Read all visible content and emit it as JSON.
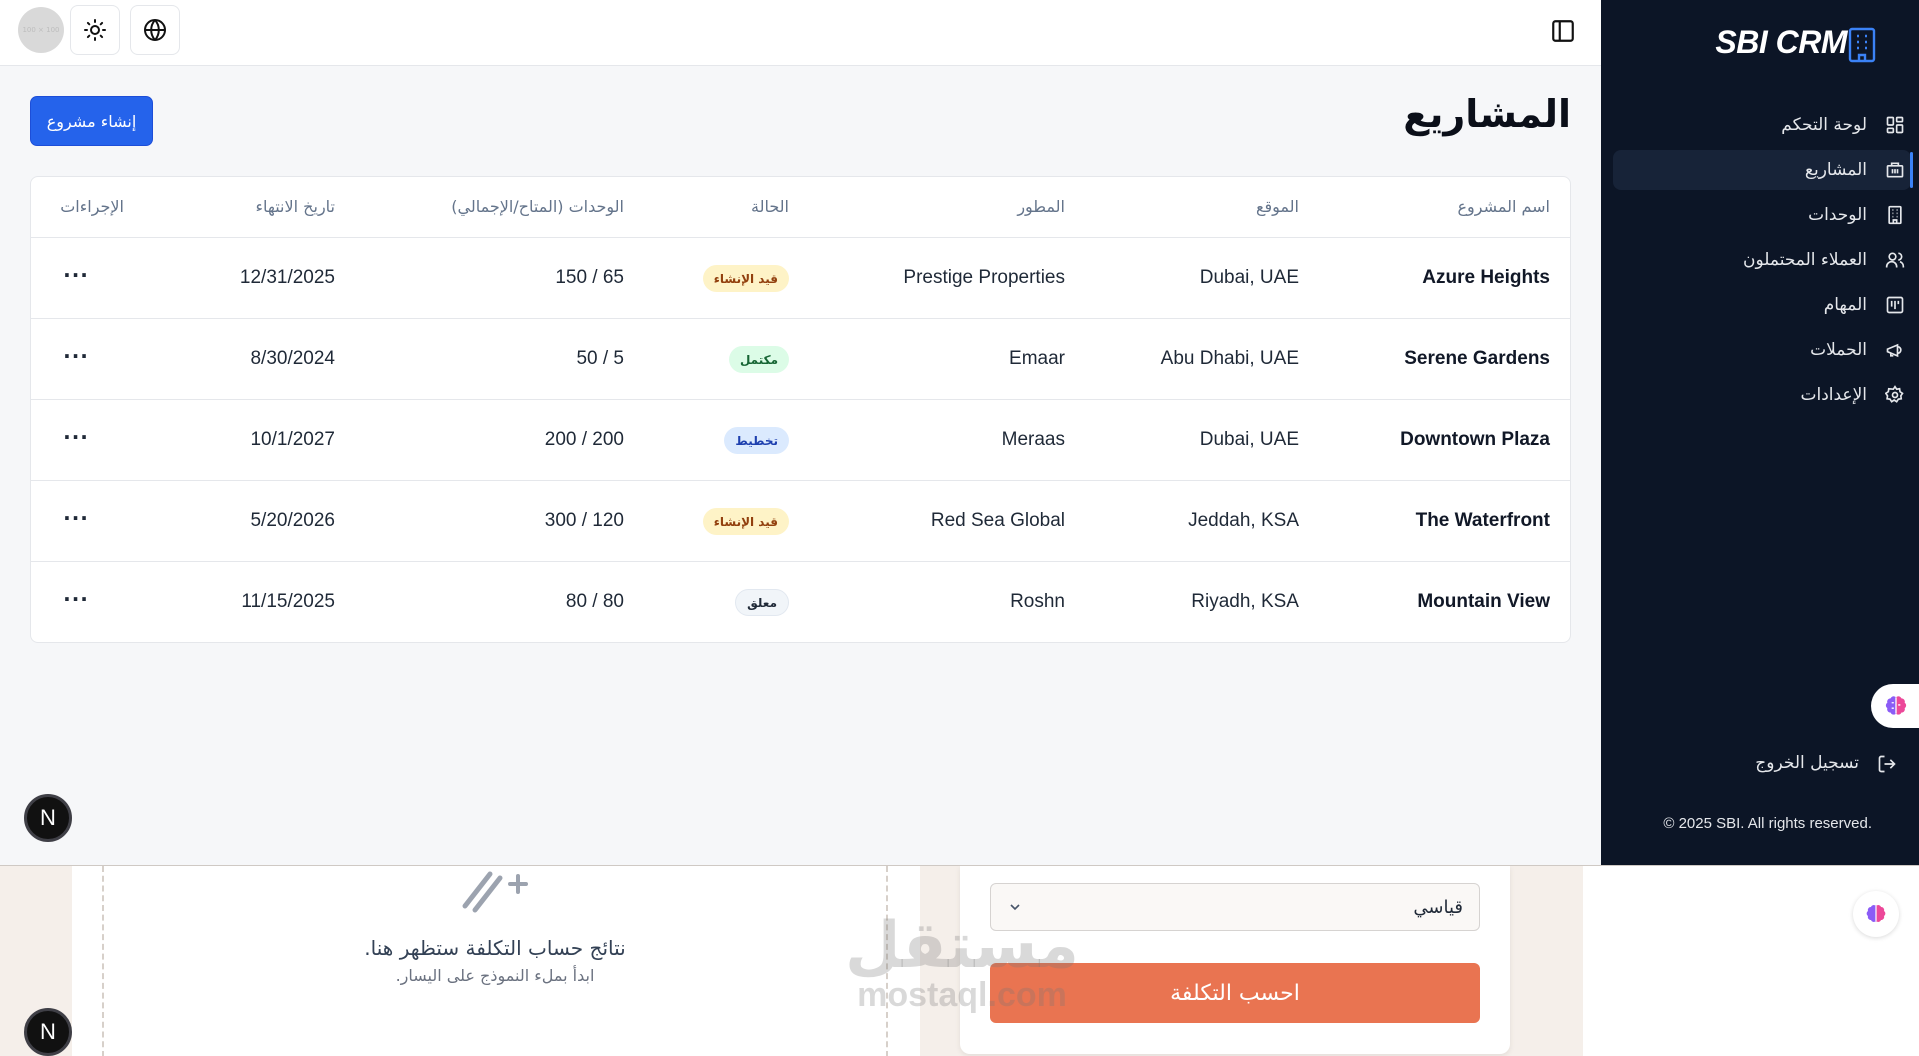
{
  "topbar": {
    "avatar_text": "100 × 100",
    "theme_icon": "sun-icon",
    "language_icon": "globe-icon",
    "panel_icon": "sidebar-toggle-icon"
  },
  "page": {
    "title": "المشاريع",
    "create_button": "إنشاء مشروع"
  },
  "table": {
    "headers": {
      "name": "اسم المشروع",
      "location": "الموقع",
      "developer": "المطور",
      "status": "الحالة",
      "units": "الوحدات (المتاح/الإجمالي)",
      "end_date": "تاريخ الانتهاء",
      "actions": "الإجراءات"
    },
    "rows": [
      {
        "name": "Azure Heights",
        "location": "Dubai, UAE",
        "developer": "Prestige Properties",
        "status": "قيد الإنشاء",
        "units": "150 / 65",
        "end_date": "12/31/2025",
        "actions": "···"
      },
      {
        "name": "Serene Gardens",
        "location": "Abu Dhabi, UAE",
        "developer": "Emaar",
        "status": "مكتمل",
        "units": "50 / 5",
        "end_date": "8/30/2024",
        "actions": "···"
      },
      {
        "name": "Downtown Plaza",
        "location": "Dubai, UAE",
        "developer": "Meraas",
        "status": "تخطيط",
        "units": "200 / 200",
        "end_date": "10/1/2027",
        "actions": "···"
      },
      {
        "name": "The Waterfront",
        "location": "Jeddah, KSA",
        "developer": "Red Sea Global",
        "status": "قيد الإنشاء",
        "units": "300 / 120",
        "end_date": "5/20/2026",
        "actions": "···"
      },
      {
        "name": "Mountain View",
        "location": "Riyadh, KSA",
        "developer": "Roshn",
        "status": "معلق",
        "units": "80 / 80",
        "end_date": "11/15/2025",
        "actions": "···"
      }
    ]
  },
  "status_colors": {
    "construction": {
      "bg": "#fef3c7",
      "fg": "#92400e"
    },
    "completed": {
      "bg": "#dcfce7",
      "fg": "#166534"
    },
    "planning": {
      "bg": "#dbeafe",
      "fg": "#1e40af"
    },
    "on_hold": {
      "bg": "#f1f5f9",
      "fg": "#1f2937"
    }
  },
  "sidebar": {
    "brand": "SBI CRM",
    "items": [
      {
        "label": "لوحة التحكم",
        "icon": "dashboard-icon"
      },
      {
        "label": "المشاريع",
        "icon": "building-icon",
        "active": true
      },
      {
        "label": "الوحدات",
        "icon": "units-icon"
      },
      {
        "label": "العملاء المحتملون",
        "icon": "users-icon"
      },
      {
        "label": "المهام",
        "icon": "tasks-icon"
      },
      {
        "label": "الحملات",
        "icon": "megaphone-icon"
      },
      {
        "label": "الإعدادات",
        "icon": "gear-icon"
      }
    ],
    "logout": "تسجيل الخروج",
    "copyright": "© 2025 SBI. All rights reserved."
  },
  "dev_badge": "N",
  "bottom": {
    "result_title": "نتائج حساب التكلفة ستظهر هنا.",
    "result_sub": "ابدأ بملء النموذج على اليسار.",
    "select_value": "قياسي",
    "calc_button": "احسب التكلفة",
    "watermark_ar": "مستقل",
    "watermark_en": "mostaql.com"
  },
  "colors": {
    "primary": "#2563eb",
    "sidebar_bg": "#0c1526",
    "accent_orange": "#e97451"
  }
}
